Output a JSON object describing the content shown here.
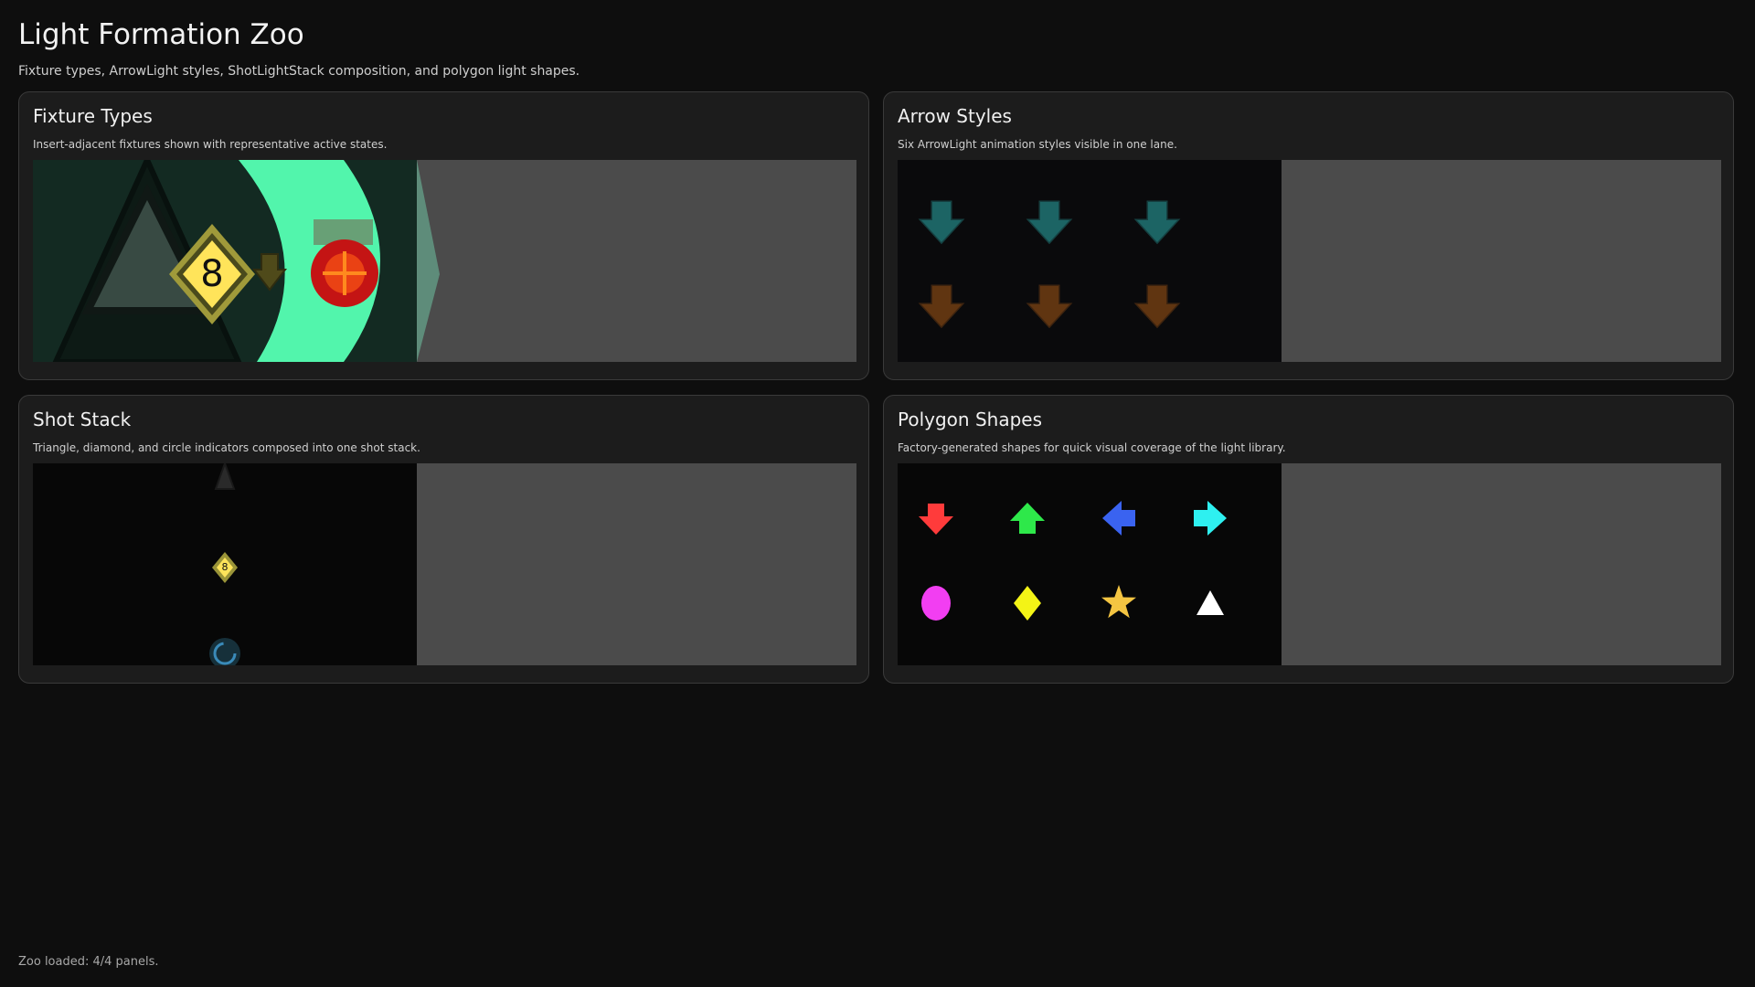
{
  "page": {
    "title": "Light Formation Zoo",
    "subtitle": "Fixture types, ArrowLight styles, ShotLightStack composition, and polygon light shapes."
  },
  "panels": {
    "fixture_types": {
      "title": "Fixture Types",
      "description": "Insert-adjacent fixtures shown with representative active states.",
      "diamond_number": "8"
    },
    "arrow_styles": {
      "title": "Arrow Styles",
      "description": "Six ArrowLight animation styles visible in one lane.",
      "rows": [
        {
          "color": "#1f6e6e",
          "count": 3
        },
        {
          "color": "#6a3a12",
          "count": 3
        }
      ]
    },
    "shot_stack": {
      "title": "Shot Stack",
      "description": "Triangle, diamond, and circle indicators composed into one shot stack.",
      "diamond_number": "8"
    },
    "polygon_shapes": {
      "title": "Polygon Shapes",
      "description": "Factory-generated shapes for quick visual coverage of the light library.",
      "shapes": [
        {
          "icon": "arrow-down-icon",
          "color": "#ff3b3b"
        },
        {
          "icon": "arrow-up-icon",
          "color": "#2ee84a"
        },
        {
          "icon": "arrow-left-icon",
          "color": "#3a63f0"
        },
        {
          "icon": "arrow-right-icon",
          "color": "#2ef0f0"
        },
        {
          "icon": "oval-icon",
          "color": "#f23ef2"
        },
        {
          "icon": "diamond-icon",
          "color": "#f4f416"
        },
        {
          "icon": "star-icon",
          "color": "#f4c542"
        },
        {
          "icon": "triangle-icon",
          "color": "#ffffff"
        }
      ]
    }
  },
  "footer": {
    "status": "Zoo loaded: 4/4 panels."
  }
}
